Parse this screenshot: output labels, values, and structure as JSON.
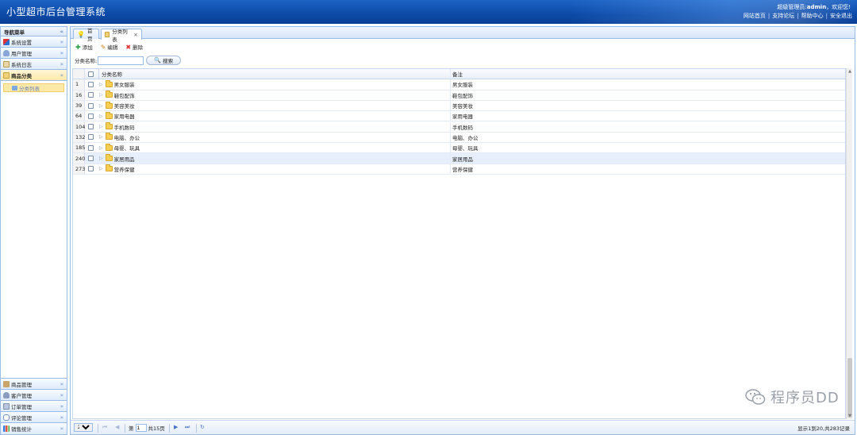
{
  "header": {
    "title": "小型超市后台管理系统",
    "welcome_prefix": "超级管理员:",
    "welcome_user": "admin",
    "welcome_suffix": "，欢迎您!",
    "links": [
      "网站首页",
      "支持论坛",
      "帮助中心",
      "安全退出"
    ],
    "colors": {
      "bar": "#0c4aa8",
      "text": "#ffffff"
    }
  },
  "sidebar": {
    "title": "导航菜单",
    "top_items": [
      {
        "label": "系统设置",
        "icon": "wrench-icon"
      },
      {
        "label": "用户管理",
        "icon": "users-icon"
      },
      {
        "label": "系统日志",
        "icon": "log-icon"
      },
      {
        "label": "商品分类",
        "icon": "category-icon",
        "active": true
      }
    ],
    "sub_item": "分类列表",
    "bottom_items": [
      {
        "label": "商品管理",
        "icon": "goods-icon"
      },
      {
        "label": "客户管理",
        "icon": "customer-icon"
      },
      {
        "label": "订单管理",
        "icon": "order-icon"
      },
      {
        "label": "评论管理",
        "icon": "comment-icon"
      },
      {
        "label": "销售统计",
        "icon": "stats-icon"
      }
    ]
  },
  "tabs": [
    {
      "label": "首页",
      "icon": "lightbulb-icon"
    },
    {
      "label": "分类列表",
      "icon": "category-icon",
      "closable": true,
      "active": true
    }
  ],
  "toolbar": {
    "add": "添加",
    "edit": "编辑",
    "delete": "删除"
  },
  "search": {
    "label": "分类名称:",
    "value": "",
    "button": "搜索"
  },
  "grid": {
    "columns": {
      "name": "分类名称",
      "note": "备注"
    },
    "rows": [
      {
        "id": "1",
        "name": "男女服装",
        "note": "男女服装"
      },
      {
        "id": "16",
        "name": "鞋包配饰",
        "note": "鞋包配饰"
      },
      {
        "id": "39",
        "name": "美容美妆",
        "note": "美容美妆"
      },
      {
        "id": "64",
        "name": "家用电器",
        "note": "家用电器"
      },
      {
        "id": "104",
        "name": "手机数码",
        "note": "手机数码"
      },
      {
        "id": "132",
        "name": "电脑、办公",
        "note": "电脑、办公"
      },
      {
        "id": "185",
        "name": "母婴、玩具",
        "note": "母婴、玩具"
      },
      {
        "id": "240",
        "name": "家居用品",
        "note": "家居用品",
        "highlight": true
      },
      {
        "id": "273",
        "name": "营养保健",
        "note": "营养保健"
      }
    ]
  },
  "pager": {
    "page_size": "20",
    "page_prefix": "第",
    "page": "1",
    "page_suffix": "共15页",
    "summary": "显示1到20,共283记录"
  },
  "watermark": "程序员DD"
}
